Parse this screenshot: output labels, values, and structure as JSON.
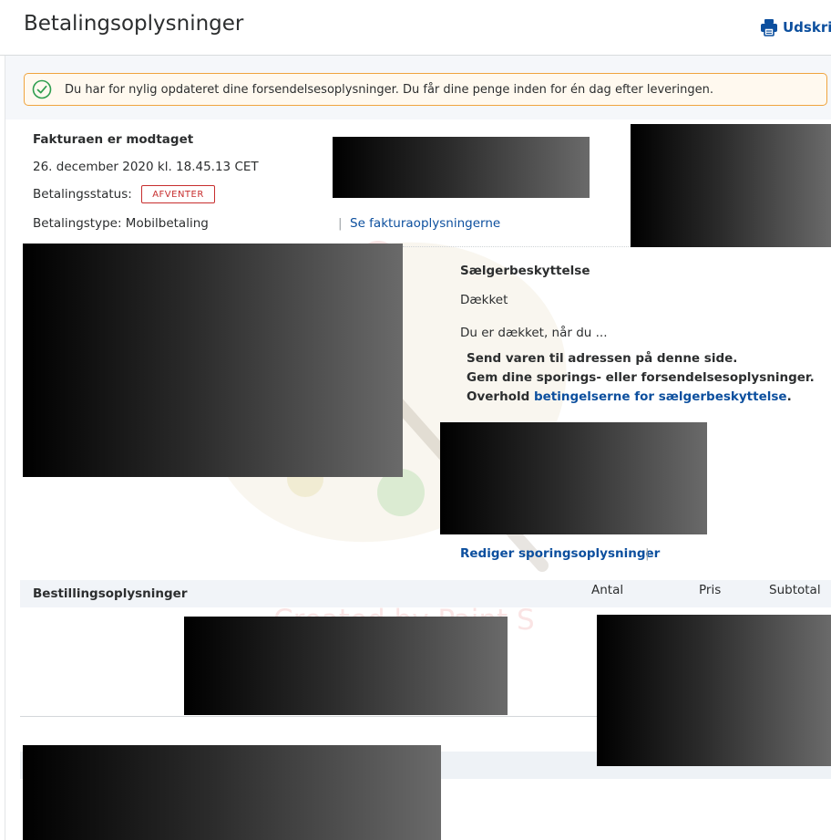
{
  "header": {
    "title": "Betalingsoplysninger",
    "print_label": "Udskriv"
  },
  "alert": {
    "text": "Du har for nylig opdateret dine forsendelsesoplysninger. Du får dine penge inden for én dag efter leveringen."
  },
  "invoice": {
    "status_title": "Fakturaen er modtaget",
    "date": "26. december 2020 kl. 18.45.13 CET",
    "payment_status_label": "Betalingsstatus:",
    "payment_status_badge": "AFVENTER",
    "payment_type": "Betalingstype: Mobilbetaling",
    "separator": "|",
    "invoice_link": "Se fakturaoplysningerne"
  },
  "seller_protection": {
    "title": "Sælgerbeskyttelse",
    "status": "Dækket",
    "intro": "Du er dækket, når du ...",
    "items": [
      "Send varen til adressen på denne side.",
      "Gem dine sporings- eller forsendelsesoplysninger."
    ],
    "third_prefix": "Overhold ",
    "third_link": "betingelserne for sælgerbeskyttelse",
    "third_suffix": "."
  },
  "tracking": {
    "edit_link": "Rediger sporingsoplysninger",
    "separator": "|"
  },
  "order": {
    "title": "Bestillingsoplysninger",
    "columns": [
      "Antal",
      "Pris",
      "Subtotal"
    ]
  },
  "watermark": "Created by Paint S",
  "colors": {
    "link": "#0c4f9e",
    "alert_border": "#f0a43e",
    "alert_bg": "#fff9ef",
    "badge": "#c72e2e",
    "success": "#2e9e4f"
  }
}
